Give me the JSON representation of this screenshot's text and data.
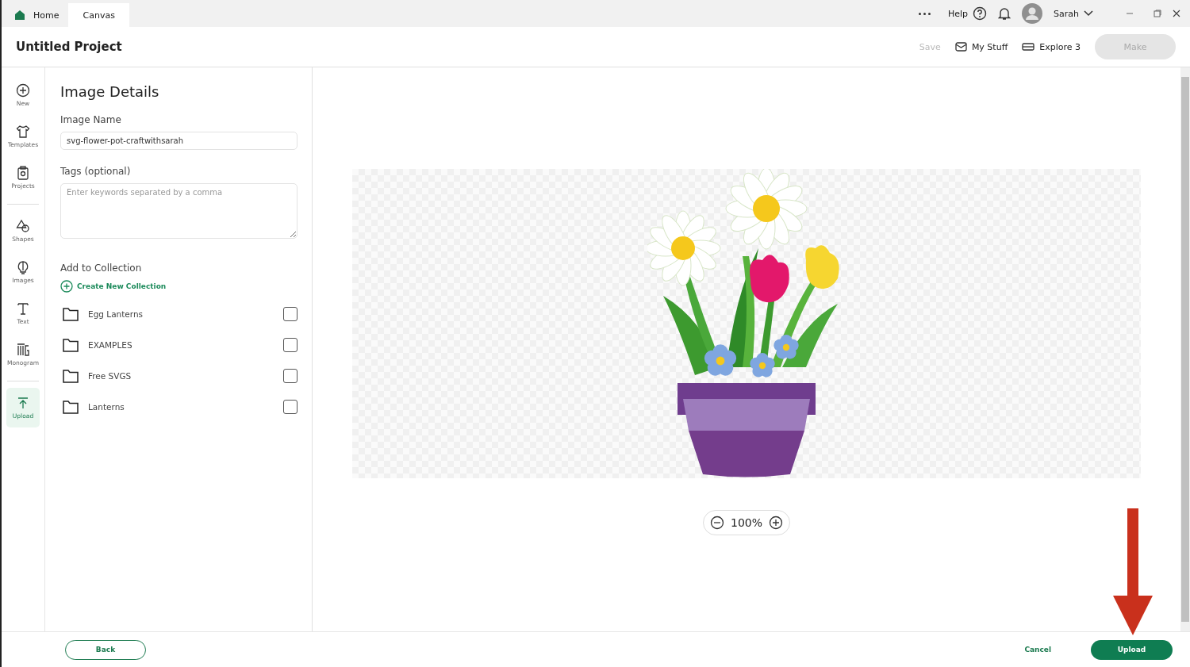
{
  "tabs": [
    {
      "label": "Home",
      "selected": false
    },
    {
      "label": "Canvas",
      "selected": true
    }
  ],
  "top_bar": {
    "help": "Help",
    "user": "Sarah"
  },
  "header": {
    "title": "Untitled Project",
    "save": {
      "label": "Save",
      "disabled": true
    },
    "my_stuff": "My Stuff",
    "machine": "Explore 3",
    "make": {
      "label": "Make",
      "disabled": true
    }
  },
  "rail": {
    "groups": [
      [
        {
          "label": "New",
          "selected": false
        },
        {
          "label": "Templates",
          "selected": false
        },
        {
          "label": "Projects",
          "selected": false
        }
      ],
      [
        {
          "label": "Shapes",
          "selected": false
        },
        {
          "label": "Images",
          "selected": false
        },
        {
          "label": "Text",
          "selected": false
        },
        {
          "label": "Monogram",
          "selected": false
        }
      ],
      [
        {
          "label": "Upload",
          "selected": true
        }
      ]
    ]
  },
  "panel": {
    "title": "Image Details",
    "name_label": "Image Name",
    "name_value": "svg-flower-pot-craftwithsarah",
    "tags_label": "Tags (optional)",
    "tags_placeholder": "Enter keywords separated by a comma",
    "collection_label": "Add to Collection",
    "create_link": "Create New Collection",
    "collections": [
      {
        "name": "Egg Lanterns",
        "checked": false
      },
      {
        "name": "EXAMPLES",
        "checked": false
      },
      {
        "name": "Free SVGS",
        "checked": false
      },
      {
        "name": "Lanterns",
        "checked": false
      }
    ]
  },
  "zoom": {
    "value": "100%"
  },
  "footer": {
    "back": "Back",
    "cancel": "Cancel",
    "upload": "Upload"
  }
}
